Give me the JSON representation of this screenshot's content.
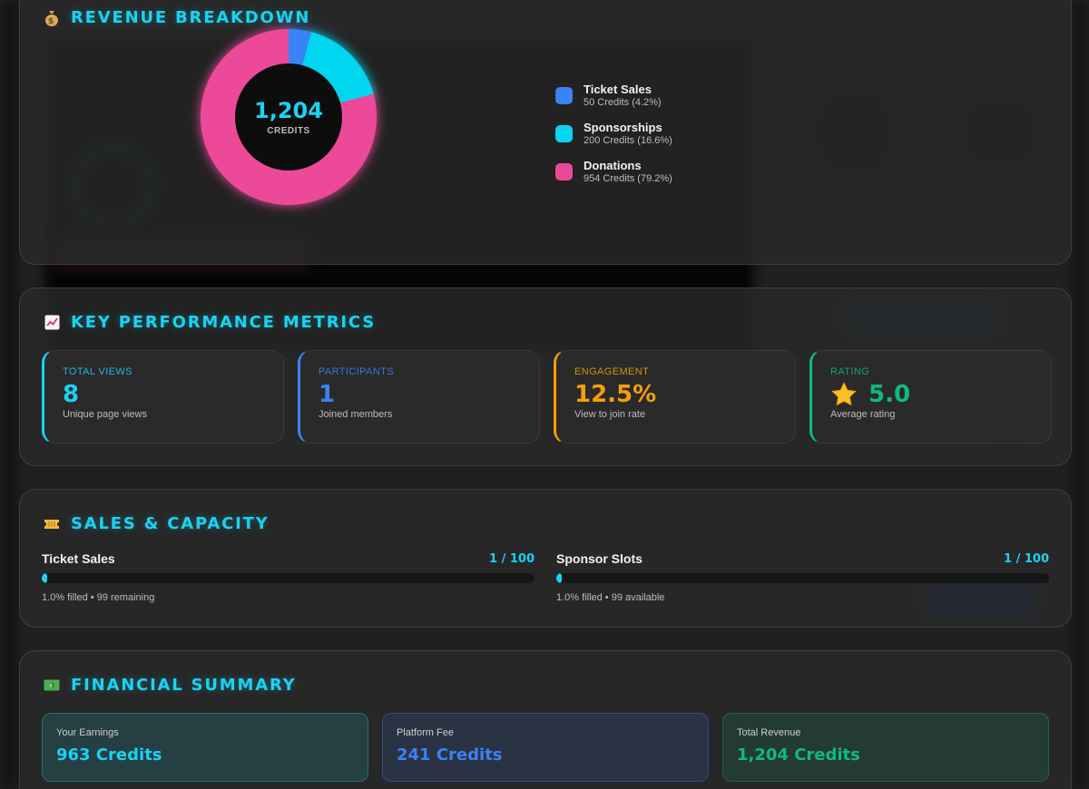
{
  "revenue": {
    "title": "REVENUE BREAKDOWN",
    "title_icon": "money-bag-icon",
    "total": "1,204",
    "unit": "CREDITS",
    "legend": [
      {
        "name": "Ticket Sales",
        "detail": "50 Credits (4.2%)",
        "color": "#3b82f6"
      },
      {
        "name": "Sponsorships",
        "detail": "200 Credits (16.6%)",
        "color": "#06d6f0"
      },
      {
        "name": "Donations",
        "detail": "954 Credits (79.2%)",
        "color": "#ec4899"
      }
    ]
  },
  "chart_data": {
    "type": "pie",
    "categories": [
      "Ticket Sales",
      "Sponsorships",
      "Donations"
    ],
    "values": [
      50,
      200,
      954
    ],
    "colors": [
      "#3b82f6",
      "#06d6f0",
      "#ec4899"
    ]
  },
  "kpi": {
    "title": "KEY PERFORMANCE METRICS",
    "title_icon": "chart-increasing-icon",
    "cards": [
      {
        "label": "TOTAL VIEWS",
        "value": "8",
        "sub": "Unique page views",
        "color": "#19d3f3"
      },
      {
        "label": "PARTICIPANTS",
        "value": "1",
        "sub": "Joined members",
        "color": "#3b82f6"
      },
      {
        "label": "ENGAGEMENT",
        "value": "12.5%",
        "sub": "View to join rate",
        "color": "#f59e0b"
      },
      {
        "label": "RATING",
        "value": "5.0",
        "sub": "Average rating",
        "color": "#10b981",
        "icon": "star-icon"
      }
    ]
  },
  "sales": {
    "title": "SALES & CAPACITY",
    "title_icon": "ticket-icon",
    "bars": [
      {
        "name": "Ticket Sales",
        "count": "1 / 100",
        "fraction": 0.01,
        "note": "1.0% filled • 99 remaining"
      },
      {
        "name": "Sponsor Slots",
        "count": "1 / 100",
        "fraction": 0.01,
        "note": "1.0% filled • 99 available"
      }
    ]
  },
  "financial": {
    "title": "FINANCIAL SUMMARY",
    "title_icon": "dollar-banknote-icon",
    "cards": [
      {
        "label": "Your Earnings",
        "value": "963 Credits",
        "color": "#19d3f3"
      },
      {
        "label": "Platform Fee",
        "value": "241 Credits",
        "color": "#3b82f6"
      },
      {
        "label": "Total Revenue",
        "value": "1,204 Credits",
        "color": "#10b981"
      }
    ]
  }
}
